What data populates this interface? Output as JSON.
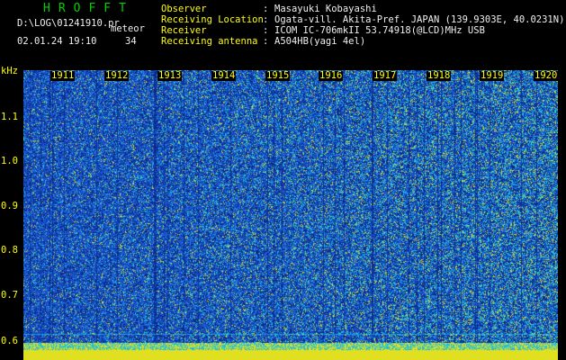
{
  "header": {
    "app_title": "HROFFT",
    "file_path": "D:\\LOG\\01241910.pr",
    "overlay_label": "meteor",
    "timestamp": "02.01.24 19:10",
    "count": "34"
  },
  "info": [
    {
      "label": "Observer",
      "value": "Masayuki Kobayashi"
    },
    {
      "label": "Receiving Location",
      "value": "Ogata-vill. Akita-Pref. JAPAN (139.9303E, 40.0231N)"
    },
    {
      "label": "Receiver",
      "value": "ICOM IC-706mkII 53.74918(@LCD)MHz USB"
    },
    {
      "label": "Receiving antenna",
      "value": "A504HB(yagi 4el)"
    }
  ],
  "colon": ":",
  "axis": {
    "unit": "kHz",
    "y_ticks": [
      "1.1",
      "1.0",
      "0.9",
      "0.8",
      "0.7",
      "0.6"
    ],
    "time_ticks": [
      "1911",
      "1912",
      "1913",
      "1914",
      "1915",
      "1916",
      "1917",
      "1918",
      "1919",
      "1920"
    ]
  },
  "colors": {
    "background": "#000000",
    "title": "#00d000",
    "label": "#ffff00",
    "text": "#f0f0f0",
    "noise_base": "#0a2a8c",
    "noise_mid": "#1e5ad6",
    "noise_high": "#22c0d8",
    "noise_peak": "#e0e020"
  }
}
